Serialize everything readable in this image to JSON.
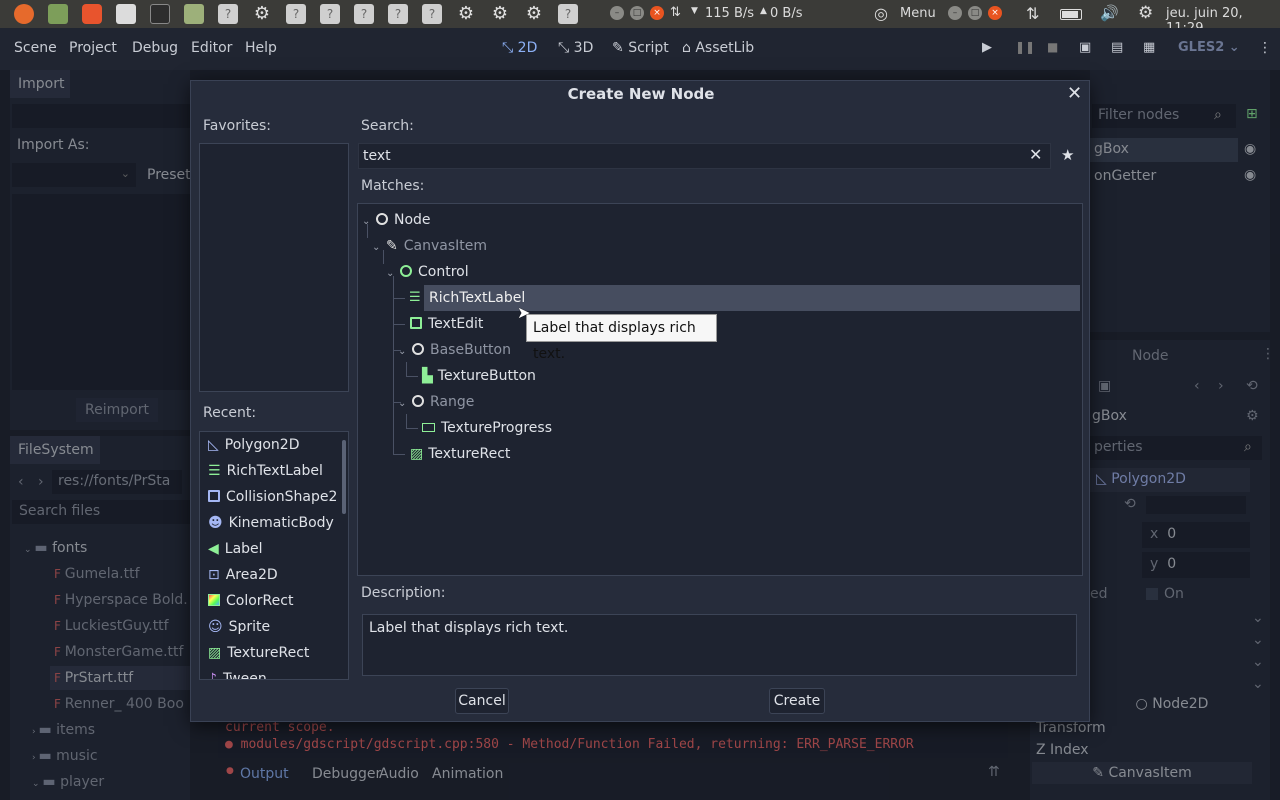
{
  "system_bar": {
    "net_down": "115 B/s",
    "net_up": "0 B/s",
    "menu_label": "Menu",
    "datetime": "jeu. juin 20, 11:29"
  },
  "editor": {
    "menu": [
      "Scene",
      "Project",
      "Debug",
      "Editor",
      "Help"
    ],
    "workspaces": [
      "2D",
      "3D",
      "Script",
      "AssetLib"
    ],
    "renderer": "GLES2",
    "import_tab": "Import",
    "import_as_label": "Import As:",
    "preset_label": "Preset",
    "reimport_label": "Reimport",
    "filesystem_tab": "FileSystem",
    "fs_path": "res://fonts/PrSta",
    "search_files_placeholder": "Search files",
    "files": [
      "fonts",
      "Gumela.ttf",
      "Hyperspace Bold.",
      "LuckiestGuy.ttf",
      "MonsterGame.ttf",
      "PrStart.ttf",
      "Renner_ 400 Boo",
      "items",
      "music",
      "player"
    ],
    "filter_nodes_placeholder": "Filter nodes",
    "scene_nodes": [
      "gBox",
      "onGetter"
    ],
    "node_tab": "Node",
    "inspector_name": "gBox",
    "properties_placeholder": "perties",
    "inspector_class": "Polygon2D",
    "x_label": "x",
    "x_value": "0",
    "y_label": "y",
    "y_value": "0",
    "prop_ed": "ed",
    "on_label": "On",
    "node2d_section": "Node2D",
    "transform_label": "Transform",
    "zindex_label": "Z Index",
    "canvasitem_section": "CanvasItem",
    "output_lines": [
      "current scope.",
      "modules/gdscript/gdscript.cpp:580 - Method/Function Failed, returning: ERR_PARSE_ERROR"
    ],
    "bottom_tabs": [
      "Output",
      "Debugger",
      "Audio",
      "Animation"
    ]
  },
  "dialog": {
    "title": "Create New Node",
    "favorites_label": "Favorites:",
    "search_label": "Search:",
    "search_value": "text",
    "matches_label": "Matches:",
    "tree": [
      {
        "label": "Node",
        "icon": "circle-white-icon"
      },
      {
        "label": "CanvasItem",
        "icon": "brush-icon"
      },
      {
        "label": "Control",
        "icon": "circle-green-icon"
      },
      {
        "label": "RichTextLabel",
        "icon": "richtext-icon"
      },
      {
        "label": "TextEdit",
        "icon": "textedit-icon"
      },
      {
        "label": "BaseButton",
        "icon": "circle-white-icon"
      },
      {
        "label": "TextureButton",
        "icon": "texturebutton-icon"
      },
      {
        "label": "Range",
        "icon": "circle-white-icon"
      },
      {
        "label": "TextureProgress",
        "icon": "textureprogress-icon"
      },
      {
        "label": "TextureRect",
        "icon": "texturerect-icon"
      }
    ],
    "tooltip": "Label that displays rich text.",
    "recent_label": "Recent:",
    "recent": [
      "Polygon2D",
      "RichTextLabel",
      "CollisionShape2",
      "KinematicBody",
      "Label",
      "Area2D",
      "ColorRect",
      "Sprite",
      "TextureRect",
      "Tween"
    ],
    "description_label": "Description:",
    "description": "Label that displays rich text.",
    "cancel_label": "Cancel",
    "create_label": "Create"
  }
}
